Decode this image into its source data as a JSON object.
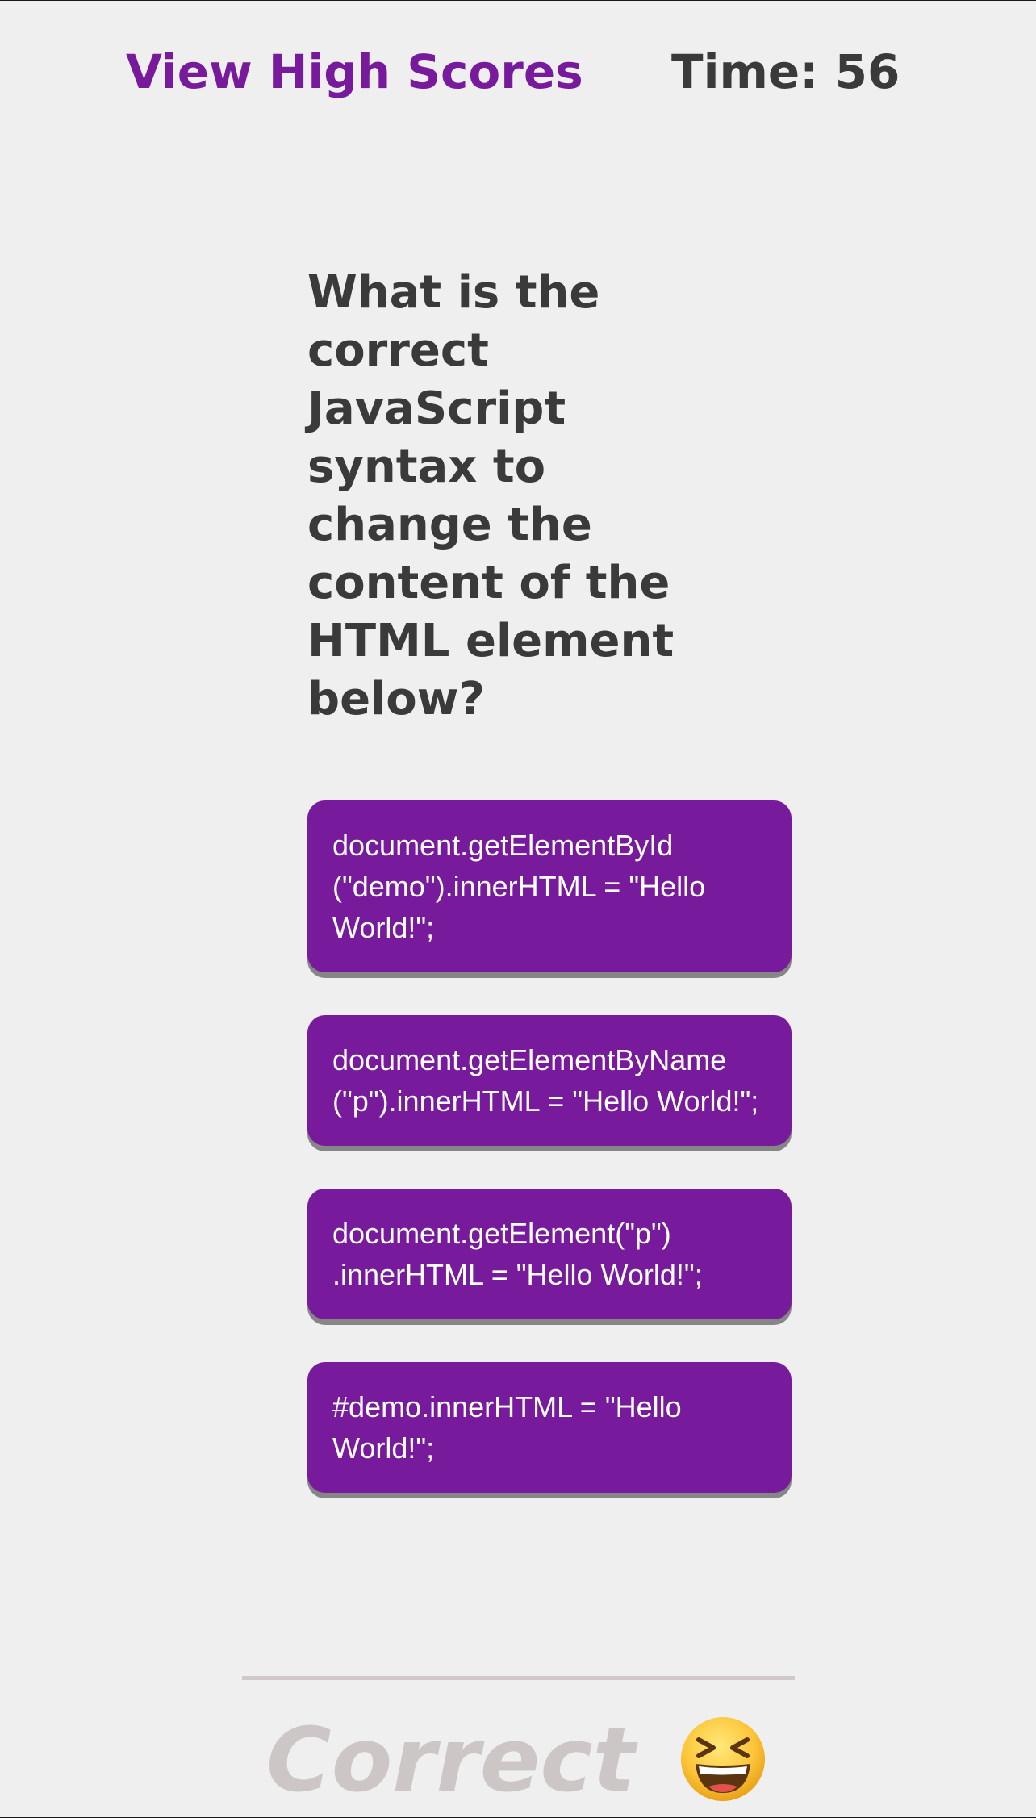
{
  "header": {
    "high_scores_label": "View High Scores",
    "timer_text": "Time: 56"
  },
  "quiz": {
    "question": "What is the correct JavaScript syntax to change the content of the HTML element below?",
    "answers": [
      "document.getElementById\n(\"demo\").innerHTML = \"Hello World!\";",
      "document.getElementByName\n(\"p\").innerHTML = \"Hello World!\";",
      "document.getElement(\"p\")\n.innerHTML = \"Hello World!\";",
      "#demo.innerHTML = \"Hello World!\";"
    ]
  },
  "feedback": {
    "result_text": "Correct",
    "icon": "grinning-squinting-face-icon"
  },
  "colors": {
    "accent": "#771a9c",
    "text": "#3a3a3a",
    "background": "#efefef",
    "button_shadow": "#868686",
    "feedback_text": "#cdc6c6"
  }
}
